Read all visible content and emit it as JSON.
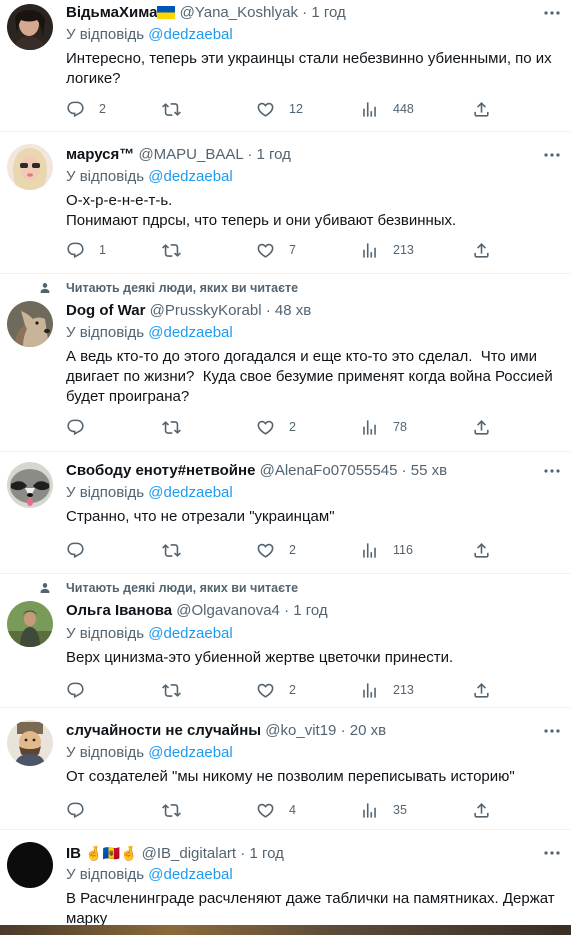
{
  "tweets": [
    {
      "name": "ВідьмаХима",
      "flag": "ua",
      "handle": "@Yana_Koshlyak",
      "time": "1 год",
      "reply_prefix": "У відповідь",
      "reply_mention": "@dedzaebal",
      "text": "Интересно, теперь эти украинцы стали небезвинно убиенными, по их логике?",
      "replies": "2",
      "retweets": "",
      "likes": "12",
      "views": "448"
    },
    {
      "name": "маруся™",
      "handle": "@MAPU_BAAL",
      "time": "1 год",
      "reply_prefix": "У відповідь",
      "reply_mention": "@dedzaebal",
      "text": "О-х-р-е-н-е-т-ь.\nПонимают пдрсы, что теперь и они убивают безвинных.",
      "replies": "1",
      "retweets": "",
      "likes": "7",
      "views": "213"
    },
    {
      "social_context": "Читають деякі люди, яких ви читаєте",
      "name": "Dog of War",
      "handle": "@PrusskyKorabl",
      "time": "48 хв",
      "reply_prefix": "У відповідь",
      "reply_mention": "@dedzaebal",
      "text": "А ведь кто-то до этого догадался и еще кто-то это сделал.  Что ими двигает по жизни?  Куда свое безумие применят когда война Россией будет проиграна?",
      "replies": "",
      "retweets": "",
      "likes": "2",
      "views": "78"
    },
    {
      "name": "Свободу еноту#нетвойне",
      "handle": "@AlenaFo07055545",
      "time": "55 хв",
      "reply_prefix": "У відповідь",
      "reply_mention": "@dedzaebal",
      "text": "Странно, что не отрезали \"украинцам\"",
      "replies": "",
      "retweets": "",
      "likes": "2",
      "views": "116"
    },
    {
      "social_context": "Читають деякі люди, яких ви читаєте",
      "name": "Ольга Іванова",
      "handle": "@Olgavanova4",
      "time": "1 год",
      "reply_prefix": "У відповідь",
      "reply_mention": "@dedzaebal",
      "text": "Верх цинизма-это убиенной жертве цветочки принести.",
      "replies": "",
      "retweets": "",
      "likes": "2",
      "views": "213"
    },
    {
      "name": "случайности не случайны",
      "handle": "@ko_vit19",
      "time": "20 хв",
      "reply_prefix": "У відповідь",
      "reply_mention": "@dedzaebal",
      "text": "От создателей \"мы никому не позволим переписывать историю\"",
      "replies": "",
      "retweets": "",
      "likes": "4",
      "views": "35"
    },
    {
      "name": "IB",
      "name_emoji": "🤞🇲🇩🤞",
      "handle": "@IB_digitalart",
      "time": "1 год",
      "reply_prefix": "У відповідь",
      "reply_mention": "@dedzaebal",
      "text": "В Расчленинграде расчленяют даже таблички на памятниках. Держат марку"
    }
  ],
  "dot": "·",
  "icons": [
    "reply-icon",
    "retweet-icon",
    "like-icon",
    "views-icon",
    "share-icon",
    "more-icon",
    "person-icon"
  ],
  "colors": {
    "text": "#0f1419",
    "secondary": "#536471",
    "link": "#1d9bf0",
    "divider": "#eff3f4"
  }
}
